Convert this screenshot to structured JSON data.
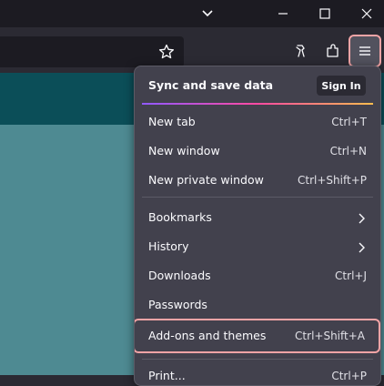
{
  "window": {
    "chevron_icon": "chevron-down-icon",
    "minimize_icon": "minimize-icon",
    "maximize_icon": "maximize-icon",
    "close_icon": "close-icon"
  },
  "toolbar": {
    "bookmark_icon": "star-icon",
    "extension_icon": "puzzle-icon",
    "app_menu_icon": "hamburger-icon"
  },
  "menu": {
    "sync_title": "Sync and save data",
    "sign_in": "Sign In",
    "items": [
      {
        "label": "New tab",
        "shortcut": "Ctrl+T"
      },
      {
        "label": "New window",
        "shortcut": "Ctrl+N"
      },
      {
        "label": "New private window",
        "shortcut": "Ctrl+Shift+P"
      },
      {
        "label": "Bookmarks",
        "shortcut": ""
      },
      {
        "label": "History",
        "shortcut": ""
      },
      {
        "label": "Downloads",
        "shortcut": "Ctrl+J"
      },
      {
        "label": "Passwords",
        "shortcut": ""
      },
      {
        "label": "Add-ons and themes",
        "shortcut": "Ctrl+Shift+A"
      },
      {
        "label": "Print...",
        "shortcut": "Ctrl+P"
      }
    ]
  },
  "colors": {
    "page_header": "#0b4e58",
    "page_body": "#4e8a92",
    "highlight": "#f3a4a6"
  }
}
